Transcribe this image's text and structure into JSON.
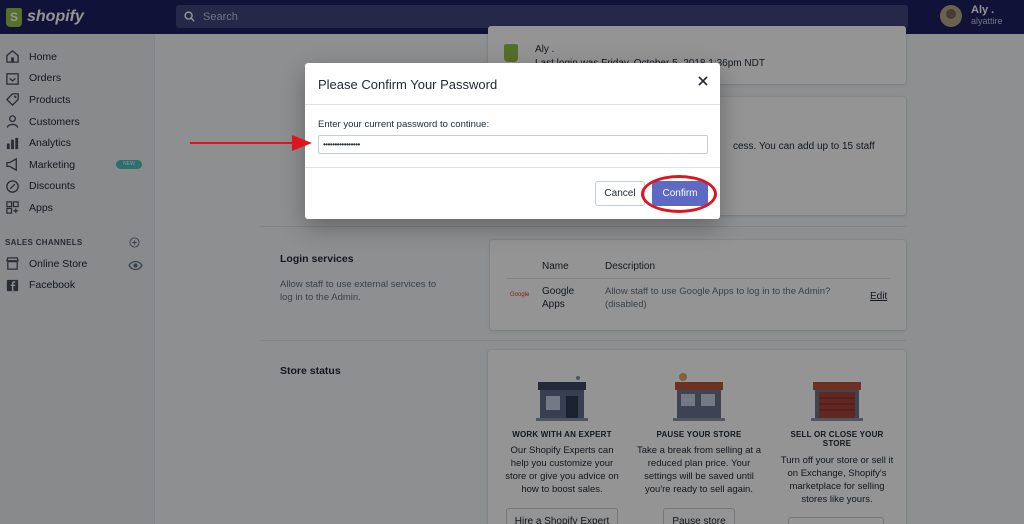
{
  "topbar": {
    "brand": "shopify",
    "search_placeholder": "Search",
    "user_name": "Aly .",
    "user_shop": "alyattire"
  },
  "sidebar": {
    "items": [
      {
        "label": "Home",
        "icon": "home-icon"
      },
      {
        "label": "Orders",
        "icon": "orders-icon"
      },
      {
        "label": "Products",
        "icon": "tag-icon"
      },
      {
        "label": "Customers",
        "icon": "person-icon"
      },
      {
        "label": "Analytics",
        "icon": "bar-chart-icon"
      },
      {
        "label": "Marketing",
        "icon": "megaphone-icon",
        "badge": "NEW"
      },
      {
        "label": "Discounts",
        "icon": "discount-icon"
      },
      {
        "label": "Apps",
        "icon": "apps-icon"
      }
    ],
    "channels_title": "SALES CHANNELS",
    "channels": [
      {
        "label": "Online Store",
        "icon": "store-icon"
      },
      {
        "label": "Facebook",
        "icon": "facebook-icon"
      }
    ]
  },
  "owner": {
    "name": "Aly .",
    "last_login": "Last login was Friday, October 5, 2018 1:36pm NDT"
  },
  "staff": {
    "text": "cess. You can add up to 15 staff"
  },
  "login_services": {
    "title": "Login services",
    "description": "Allow staff to use external services to log in to the Admin.",
    "col_name": "Name",
    "col_description": "Description",
    "row": {
      "logo": "Google",
      "name_line1": "Google",
      "name_line2": "Apps",
      "desc_line1": "Allow staff to use Google Apps to log in to the Admin?",
      "desc_line2": "(disabled)",
      "action": "Edit"
    }
  },
  "store_status": {
    "title": "Store status",
    "columns": [
      {
        "title": "WORK WITH AN EXPERT",
        "lines": [
          "Our Shopify Experts can",
          "help you customize your",
          "store or give you advice on",
          "how to boost sales."
        ],
        "button": "Hire a Shopify Expert"
      },
      {
        "title": "PAUSE YOUR STORE",
        "lines": [
          "Take a break from selling at a",
          "reduced plan price. Your",
          "settings will be saved until",
          "you're ready to sell again."
        ],
        "button": "Pause store"
      },
      {
        "title_line1": "SELL OR CLOSE YOUR",
        "title_line2": "STORE",
        "lines": [
          "Turn off your store or sell it",
          "on Exchange, Shopify's",
          "marketplace for selling",
          "stores like yours."
        ]
      }
    ]
  },
  "modal": {
    "title": "Please Confirm Your Password",
    "label": "Enter your current password to continue:",
    "password_value": "••••••••••••••••",
    "cancel": "Cancel",
    "confirm": "Confirm"
  },
  "colors": {
    "topbar": "#1c2260",
    "primary_button": "#5c6ac4",
    "annotation": "#e0141e",
    "shopify_green": "#95bf47"
  }
}
